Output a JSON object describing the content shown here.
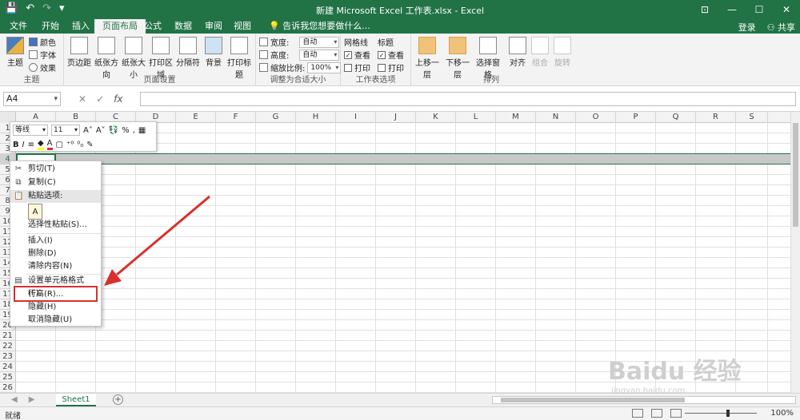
{
  "window": {
    "title": "新建 Microsoft Excel 工作表.xlsx - Excel",
    "buttons": [
      "⊡",
      "—",
      "☐",
      "✕"
    ]
  },
  "qat": [
    "💾",
    "↶",
    "↷",
    "▾"
  ],
  "tabs": [
    {
      "label": "文件"
    },
    {
      "label": "开始"
    },
    {
      "label": "插入"
    },
    {
      "label": "页面布局",
      "active": true
    },
    {
      "label": "公式"
    },
    {
      "label": "数据"
    },
    {
      "label": "审阅"
    },
    {
      "label": "视图"
    },
    {
      "label": "告诉我您想要做什么..."
    }
  ],
  "account": {
    "login": "登录",
    "share": "共享"
  },
  "ribbon": {
    "themes": {
      "big": "主题",
      "colors": "颜色",
      "fonts": "字体",
      "effects": "效果",
      "group": "主题"
    },
    "pagesetup": {
      "buttons": [
        "页边距",
        "纸张方向",
        "纸张大小",
        "打印区域",
        "分隔符",
        "背景",
        "打印标题"
      ],
      "group": "页面设置"
    },
    "scale": {
      "width_label": "宽度:",
      "width_value": "自动",
      "height_label": "高度:",
      "height_value": "自动",
      "scale_label": "缩放比例:",
      "scale_value": "100%",
      "group": "调整为合适大小"
    },
    "sheetopts": {
      "gridlines": "网格线",
      "headings": "标题",
      "view1": "查看",
      "view2": "查看",
      "print1": "打印",
      "print2": "打印",
      "group": "工作表选项"
    },
    "arrange": {
      "buttons": [
        "上移一层",
        "下移一层",
        "选择窗格",
        "对齐",
        "组合",
        "旋转"
      ],
      "group": "排列"
    }
  },
  "formula": {
    "namebox": "A4",
    "fx": "fx"
  },
  "grid": {
    "columns": [
      "A",
      "B",
      "C",
      "D",
      "E",
      "F",
      "G",
      "H",
      "I",
      "J",
      "K",
      "L",
      "M",
      "N",
      "O",
      "P",
      "Q",
      "R",
      "S"
    ],
    "rows": [
      "1",
      "2",
      "3",
      "4",
      "5",
      "6",
      "7",
      "8",
      "9",
      "10",
      "11",
      "12",
      "13",
      "14",
      "15",
      "16",
      "17",
      "18",
      "19",
      "20",
      "21",
      "22",
      "23",
      "24",
      "25",
      "26"
    ]
  },
  "minibar": {
    "font": "等线",
    "size": "11",
    "grow": "A˄",
    "shrink": "A˅",
    "percent": "%",
    "comma": "‚",
    "bold": "B",
    "italic": "I",
    "align": "≡"
  },
  "context_menu": {
    "cut": "剪切(T)",
    "copy": "复制(C)",
    "paste_options": "粘贴选项:",
    "paste_icon": "A",
    "paste_special": "选择性粘贴(S)...",
    "insert": "插入(I)",
    "delete": "删除(D)",
    "clear": "清除内容(N)",
    "format_cells": "设置单元格格式(F)...",
    "row_height": "行高(R)...",
    "hide": "隐藏(H)",
    "unhide": "取消隐藏(U)"
  },
  "sheets": {
    "tab": "Sheet1",
    "add": "+"
  },
  "status": {
    "ready": "就绪",
    "zoom": "100%"
  },
  "watermark": {
    "logo": "Baidu 经验",
    "url": "jingyan.baidu.com"
  },
  "colors": {
    "brand": "#217346",
    "highlight": "#d9302c"
  }
}
